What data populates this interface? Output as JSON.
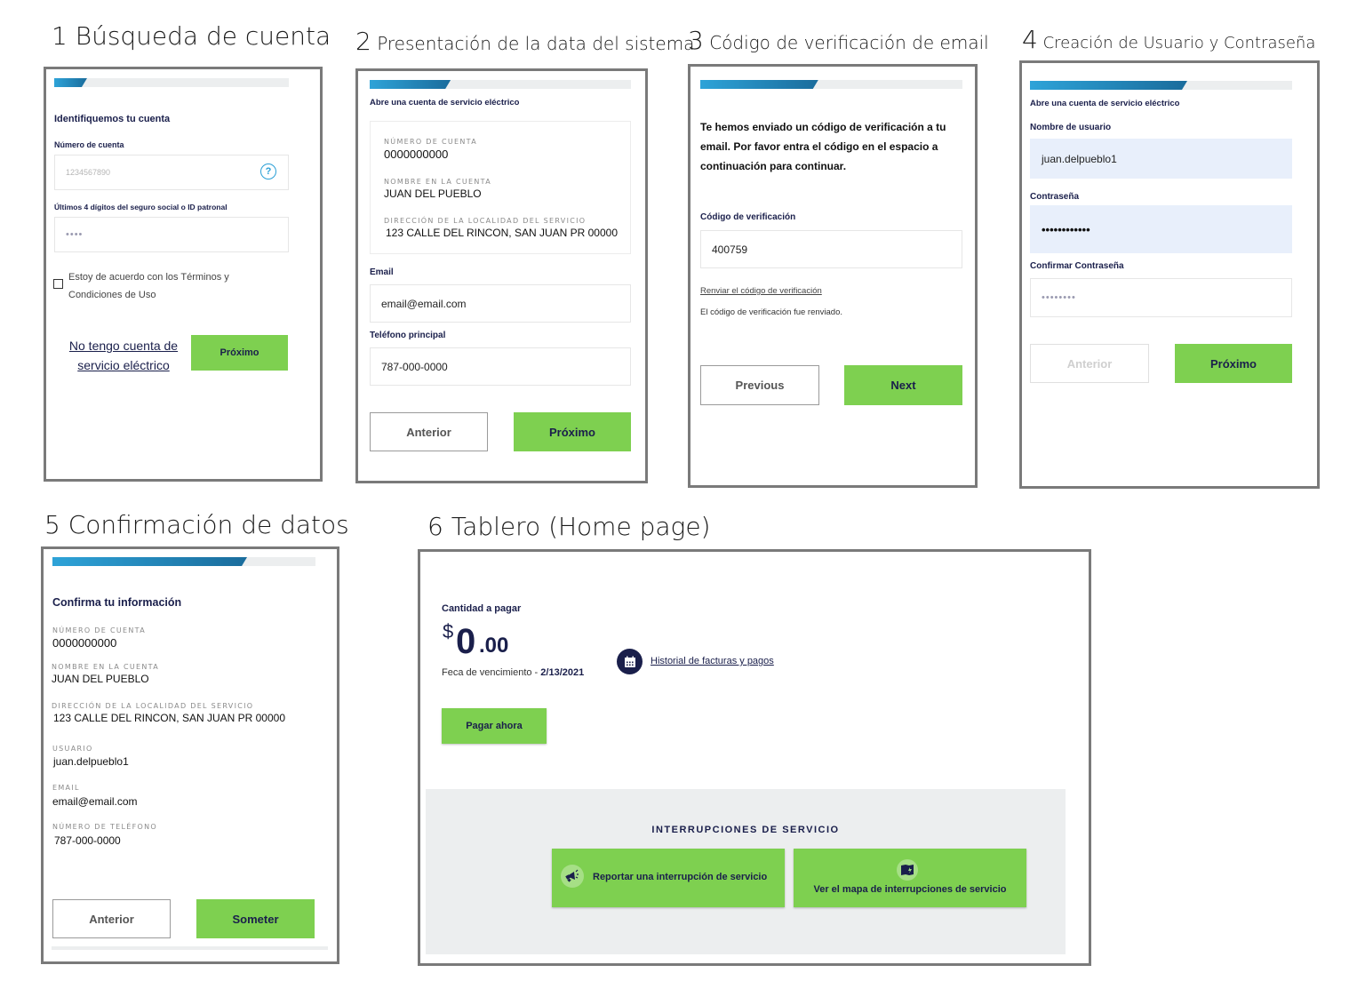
{
  "steps": [
    {
      "num": "1",
      "title": "Búsqueda de cuenta"
    },
    {
      "num": "2",
      "title": "Presentación de la data del sistema"
    },
    {
      "num": "3",
      "title": "Código de verificación de email"
    },
    {
      "num": "4",
      "title": "Creación de Usuario y Contraseña"
    },
    {
      "num": "5",
      "title": "Confirmación de datos"
    },
    {
      "num": "6",
      "title": "Tablero (Home page)"
    }
  ],
  "colors": {
    "primary_green": "#7ed050",
    "navy": "#1a1f4b",
    "progress_start": "#2ea3d8",
    "progress_end": "#1a6c9c",
    "help_blue": "#2a9fd6",
    "panel_grey": "#eceeef"
  },
  "panel1": {
    "progress_pct": 14,
    "heading": "Identifiquemos tu cuenta",
    "account_label": "Número de cuenta",
    "account_placeholder": "1234567890",
    "help_icon": "?",
    "ssn_label": "Últimos 4 dígitos del seguro social o ID patronal",
    "ssn_value": "••••",
    "terms_line1": "Estoy de acuerdo con los Términos y",
    "terms_line2": "Condiciones de Uso",
    "terms_checked": false,
    "no_account_line1": "No tengo cuenta de",
    "no_account_line2": "servicio eléctrico",
    "next": "Próximo"
  },
  "panel2": {
    "progress_pct": 31,
    "subtitle": "Abre una cuenta de servicio eléctrico",
    "account_label": "NÚMERO DE CUENTA",
    "account_value": "0000000000",
    "name_label": "NOMBRE EN LA CUENTA",
    "name_value": "JUAN DEL PUEBLO",
    "address_label": "DIRECCIÓN DE LA LOCALIDAD DEL SERVICIO",
    "address_value": "123 CALLE DEL RINCON, SAN JUAN PR 00000",
    "email_label": "Email",
    "email_value": "email@email.com",
    "phone_label": "Teléfono principal",
    "phone_value": "787-000-0000",
    "prev": "Anterior",
    "next": "Próximo"
  },
  "panel3": {
    "progress_pct": 45,
    "message": "Te hemos enviado un código de verificación a tu email. Por favor entra el código en el espacio a continuación para continuar.",
    "code_label": "Código de verificación",
    "code_value": "400759",
    "resend_link": "Renviar el código de verificación",
    "resend_status": "El código de verificación fue renviado.",
    "prev": "Previous",
    "next": "Next"
  },
  "panel4": {
    "progress_pct": 60,
    "subtitle": "Abre una cuenta de servicio eléctrico",
    "username_label": "Nombre de usuario",
    "username_value": "juan.delpueblo1",
    "password_label": "Contraseña",
    "password_value": "••••••••••••",
    "confirm_label": "Confirmar Contraseña",
    "confirm_value": "••••••••",
    "prev": "Anterior",
    "next": "Próximo"
  },
  "panel5": {
    "progress_pct": 74,
    "heading": "Confirma tu información",
    "account_label": "NÚMERO DE CUENTA",
    "account_value": "0000000000",
    "name_label": "NOMBRE EN LA CUENTA",
    "name_value": "JUAN DEL PUEBLO",
    "address_label": "DIRECCIÓN DE LA LOCALIDAD DEL SERVICIO",
    "address_value": "123 CALLE DEL RINCON, SAN JUAN PR 00000",
    "user_label": "USUARIO",
    "user_value": "juan.delpueblo1",
    "email_label": "EMAIL",
    "email_value": "email@email.com",
    "phone_label": "NÚMERO DE TELÉFONO",
    "phone_value": "787-000-0000",
    "prev": "Anterior",
    "submit": "Someter"
  },
  "panel6": {
    "amount_label": "Cantidad a pagar",
    "amount_symbol": "$",
    "amount_int": "0",
    "amount_dec": ".00",
    "due_label": "Feca de vencimiento - ",
    "due_date": "2/13/2021",
    "history_link": "Historial de facturas y pagos",
    "pay_now": "Pagar ahora",
    "outage_heading": "INTERRUPCIONES DE SERVICIO",
    "report_outage": "Reportar una interrupción de servicio",
    "outage_map": "Ver el mapa de interrupciones de servicio"
  }
}
